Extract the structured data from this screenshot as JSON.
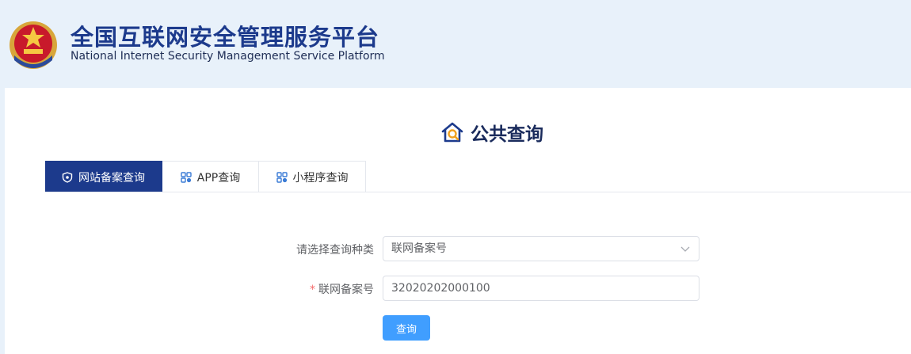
{
  "header": {
    "title_cn": "全国互联网安全管理服务平台",
    "title_en": "National Internet Security Management Service Platform",
    "emblem_icon": "police-emblem-icon"
  },
  "page": {
    "heading": "公共查询",
    "heading_icon": "house-search-icon"
  },
  "tabs": [
    {
      "label": "网站备案查询",
      "icon": "shield-icon",
      "active": true
    },
    {
      "label": "APP查询",
      "icon": "app-grid-icon",
      "active": false
    },
    {
      "label": "小程序查询",
      "icon": "app-grid-icon",
      "active": false
    }
  ],
  "form": {
    "query_type_label": "请选择查询种类",
    "query_type_value": "联网备案号",
    "record_required_mark": "*",
    "record_label": "联网备案号",
    "record_value": "32020202000100",
    "submit_label": "查询"
  },
  "colors": {
    "brand_blue": "#1c3a8c",
    "header_bg": "#e8f1fa",
    "button_blue": "#409eff",
    "required_red": "#f56c6c"
  }
}
